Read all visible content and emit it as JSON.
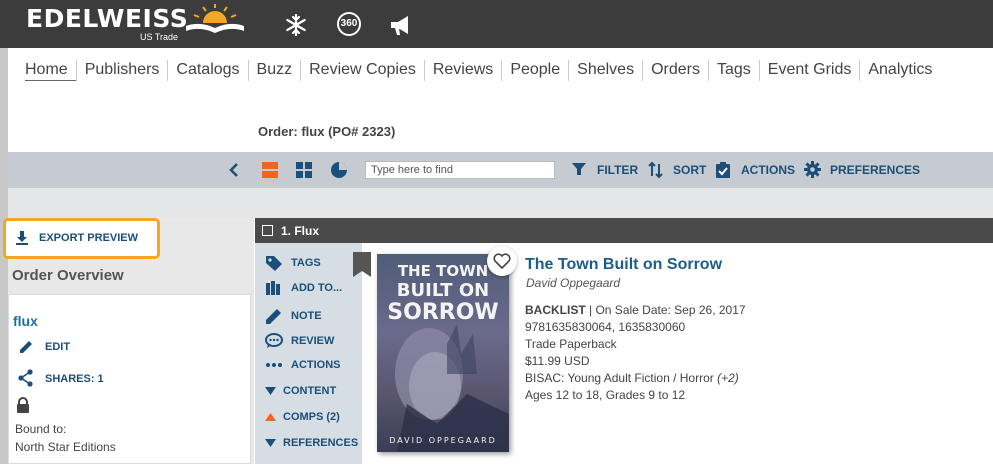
{
  "header": {
    "logo_text": "EDELWEISS",
    "logo_sub": "US Trade",
    "icons": [
      "snowflake-icon",
      "360-icon",
      "megaphone-icon"
    ],
    "icon_360_text": "360"
  },
  "nav": {
    "items": [
      "Home",
      "Publishers",
      "Catalogs",
      "Buzz",
      "Review Copies",
      "Reviews",
      "People",
      "Shelves",
      "Orders",
      "Tags",
      "Event Grids",
      "Analytics"
    ]
  },
  "order": {
    "title": "Order: flux (PO# 2323)"
  },
  "toolbar": {
    "search_placeholder": "Type here to find",
    "filter": "FILTER",
    "sort": "SORT",
    "actions": "ACTIONS",
    "preferences": "PREFERENCES",
    "accent_color": "#f06522"
  },
  "left": {
    "export_label": "EXPORT PREVIEW",
    "overview_title": "Order Overview",
    "order_name": "flux",
    "edit_label": "EDIT",
    "shares_label": "SHARES: 1",
    "bound_to_label": "Bound to:",
    "bound_to_value": "North Star Editions"
  },
  "item": {
    "header": "1. Flux",
    "actions": [
      "TAGS",
      "ADD TO...",
      "NOTE",
      "REVIEW",
      "ACTIONS",
      "CONTENT",
      "COMPS (2)",
      "REFERENCES"
    ],
    "cover": {
      "line1": "THE TOWN",
      "line2": "BUILT ON",
      "line3": "SORROW",
      "author": "DAVID OPPEGAARD"
    },
    "title": "The Town Built on Sorrow",
    "author": "David Oppegaard",
    "status": "BACKLIST",
    "sale_date": "| On Sale Date: Sep 26, 2017",
    "isbn": "9781635830064, 1635830060",
    "format": "Trade Paperback",
    "price": "$11.99 USD",
    "bisac": "BISAC: Young Adult Fiction / Horror",
    "bisac_more": "(+2)",
    "ages": "Ages 12 to 18, Grades 9 to 12"
  }
}
